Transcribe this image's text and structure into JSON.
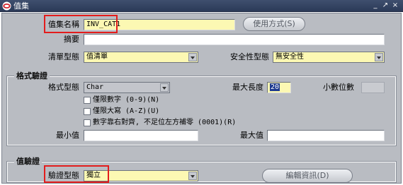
{
  "window": {
    "title": "值集",
    "controls": [
      "_",
      "↗",
      "×"
    ]
  },
  "header": {
    "value_set_name_label": "值集名稱",
    "value_set_name_value": "INV_CAT1",
    "usage_button": "使用方式(S)",
    "description_label": "摘要",
    "description_value": "",
    "list_type_label": "清單型態",
    "list_type_value": "值清單",
    "security_type_label": "安全性型態",
    "security_type_value": "無安全性"
  },
  "format_validation": {
    "title": "格式驗證",
    "format_type_label": "格式型態",
    "format_type_value": "Char",
    "max_size_label": "最大長度",
    "max_size_value": "20",
    "precision_label": "小數位數",
    "precision_value": "",
    "numbers_only_label": "僅限數字 (0-9)(N)",
    "uppercase_only_label": "僅限大寫 (A-Z)(U)",
    "right_justify_label": "數字靠右對齊, 不足位左方補零 (0001)(R)",
    "min_value_label": "最小值",
    "min_value_value": "",
    "max_value_label": "最大值",
    "max_value_value": ""
  },
  "value_validation": {
    "title": "值驗證",
    "validation_type_label": "驗證型態",
    "validation_type_value": "獨立",
    "edit_info_button": "編輯資訊(D)"
  },
  "colors": {
    "required_field": "#fcf8b3",
    "panel": "#b9bcc2",
    "highlight_box": "#e31c1c",
    "title_bar": "#34456a"
  }
}
